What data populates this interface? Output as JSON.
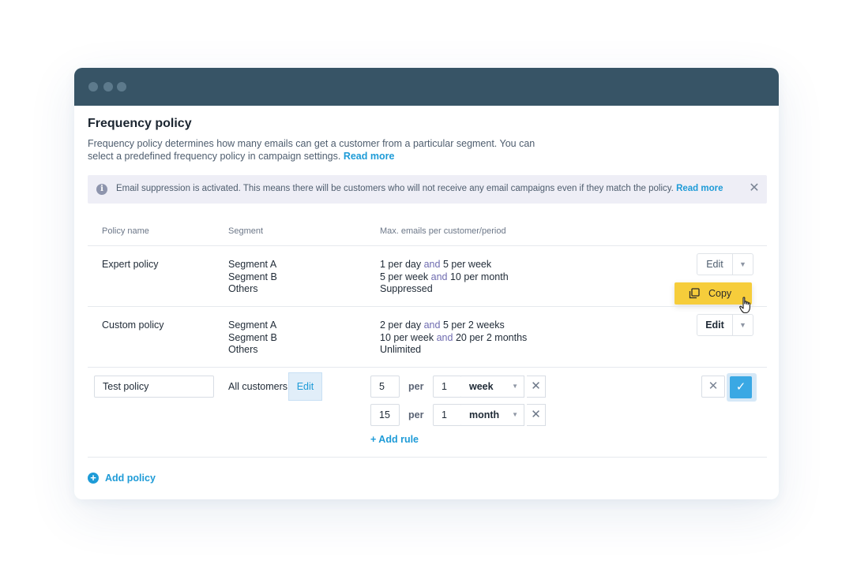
{
  "header": {
    "title": "Frequency policy",
    "description": "Frequency policy determines how many emails can get a customer from a particular segment. You can select a predefined frequency policy in campaign settings.",
    "read_more": "Read more"
  },
  "banner": {
    "text": "Email suppression is activated. This means there will be customers  who will not receive any email campaigns even if they match the policy.",
    "read_more": "Read more",
    "info_glyph": "i",
    "close_glyph": "✕"
  },
  "table": {
    "headers": [
      "Policy name",
      "Segment",
      "Max. emails per customer/period"
    ],
    "rows": [
      {
        "name": "Expert policy",
        "segments": [
          "Segment A",
          "Segment B",
          "Others"
        ],
        "rules": [
          {
            "a": "1 per day",
            "and": "and",
            "b": "5 per week"
          },
          {
            "a": "5 per week",
            "and": "and",
            "b": "10 per month"
          },
          {
            "a": "Suppressed"
          }
        ],
        "edit_label": "Edit"
      },
      {
        "name": "Custom policy",
        "segments": [
          "Segment A",
          "Segment B",
          "Others"
        ],
        "rules": [
          {
            "a": "2 per day",
            "and": "and",
            "b": "5 per 2 weeks"
          },
          {
            "a": "10 per week",
            "and": "and",
            "b": "20 per 2 months"
          },
          {
            "a": "Unlimited"
          }
        ],
        "edit_label": "Edit"
      }
    ]
  },
  "copy_menu": {
    "label": "Copy"
  },
  "edit_row": {
    "name_value": "Test policy",
    "segment": "All customers",
    "segment_edit": "Edit",
    "per_label": "per",
    "rules": [
      {
        "count": "5",
        "period_count": "1",
        "period": "week"
      },
      {
        "count": "15",
        "period_count": "1",
        "period": "month"
      }
    ],
    "add_rule": "+ Add rule"
  },
  "footer": {
    "add_policy": "Add policy"
  },
  "glyphs": {
    "caret": "▼",
    "x": "✕",
    "check": "✓",
    "plus": "+"
  },
  "colors": {
    "titlebar": "#375466",
    "accent": "#1e9bd7",
    "copy_bg": "#f6cd3b",
    "confirm": "#3aa8e4",
    "banner_bg": "#eeeef6"
  }
}
